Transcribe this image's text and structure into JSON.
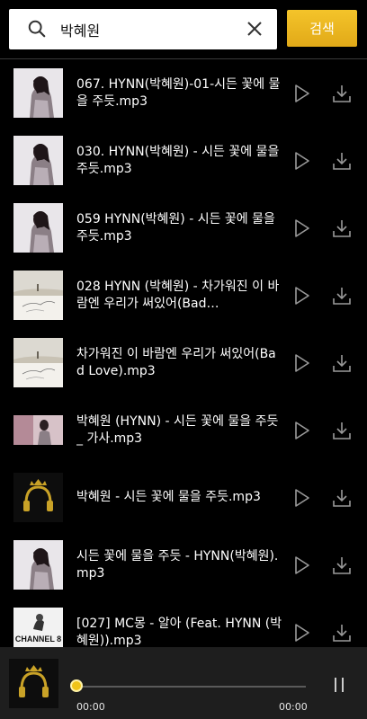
{
  "search": {
    "value": "박혜원",
    "button_label": "검색"
  },
  "results": [
    {
      "title": "067. HYNN(박혜원)-01-시든 꽃에 물을 주듯.mp3",
      "thumb": "portrait"
    },
    {
      "title": "030. HYNN(박혜원) - 시든 꽃에 물을 주듯.mp3",
      "thumb": "portrait"
    },
    {
      "title": "059 HYNN(박혜원) - 시든 꽃에 물을 주듯.mp3",
      "thumb": "portrait"
    },
    {
      "title": "028 HYNN (박혜원) - 차가워진 이 바람엔 우리가 써있어(Bad…",
      "thumb": "landscape"
    },
    {
      "title": "차가워진 이 바람엔 우리가 써있어(Bad Love).mp3",
      "thumb": "landscape"
    },
    {
      "title": "박혜원 (HYNN) - 시든 꽃에 물을 주듯 _ 가사.mp3",
      "thumb": "portrait-wide"
    },
    {
      "title": "박혜원 - 시든 꽃에 물을 주듯.mp3",
      "thumb": "headphones"
    },
    {
      "title": "시든 꽃에 물을 주듯 - HYNN(박혜원).mp3",
      "thumb": "portrait"
    },
    {
      "title": "[027] MC몽 - 알아 (Feat. HYNN (박혜원)).mp3",
      "thumb": "channel8",
      "thumb_text": "CHANNEL 8"
    }
  ],
  "player": {
    "time_current": "00:00",
    "time_total": "00:00",
    "progress": 0
  },
  "colors": {
    "accent": "#f0c419",
    "background": "#000000",
    "player_bg": "#1e1e1e"
  },
  "icons": [
    "search-icon",
    "clear-icon",
    "play-icon",
    "download-icon",
    "pause-icon",
    "headphones-icon"
  ]
}
